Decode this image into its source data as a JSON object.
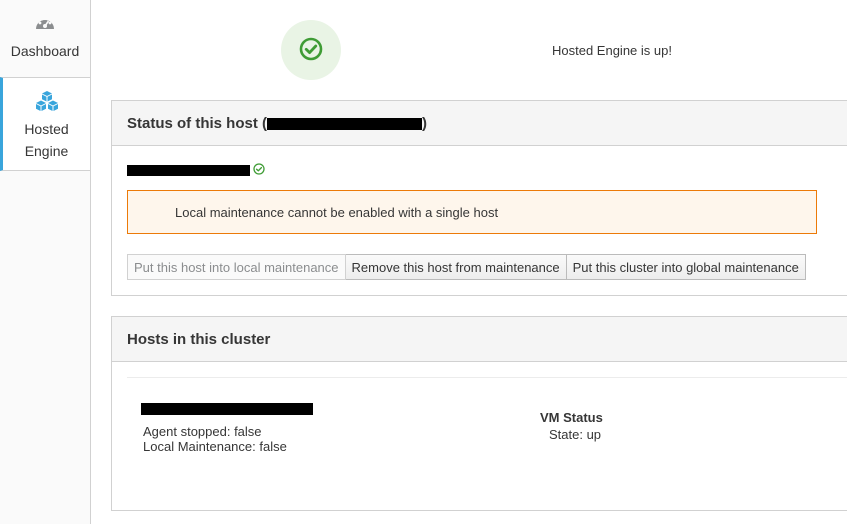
{
  "sidebar": {
    "items": [
      {
        "label": "Dashboard",
        "icon": "dashboard-gauge-icon",
        "active": false
      },
      {
        "label": "Hosted\nEngine",
        "label_line1": "Hosted",
        "label_line2": "Engine",
        "icon": "cubes-icon",
        "active": true
      }
    ]
  },
  "top_status": {
    "text": "Hosted Engine is up!",
    "icon": "check-circle-icon"
  },
  "host_panel": {
    "title_prefix": "Status of this host (",
    "title_suffix": ")",
    "alert_text": "Local maintenance cannot be enabled with a single host",
    "buttons": [
      {
        "label": "Put this host into local maintenance",
        "disabled": true
      },
      {
        "label": "Remove this host from maintenance",
        "disabled": false
      },
      {
        "label": "Put this cluster into global maintenance",
        "disabled": false
      }
    ]
  },
  "cluster_panel": {
    "title": "Hosts in this cluster",
    "host": {
      "agent_stopped": "Agent stopped: false",
      "local_maintenance": "Local Maintenance: false",
      "vm_status_title": "VM Status",
      "vm_state": "State: up"
    }
  },
  "colors": {
    "accent": "#39a5dc",
    "success": "#3f9c35",
    "success_bg": "#e9f4e5",
    "warning_border": "#ec7a08",
    "warning_bg": "#fef6ec"
  }
}
